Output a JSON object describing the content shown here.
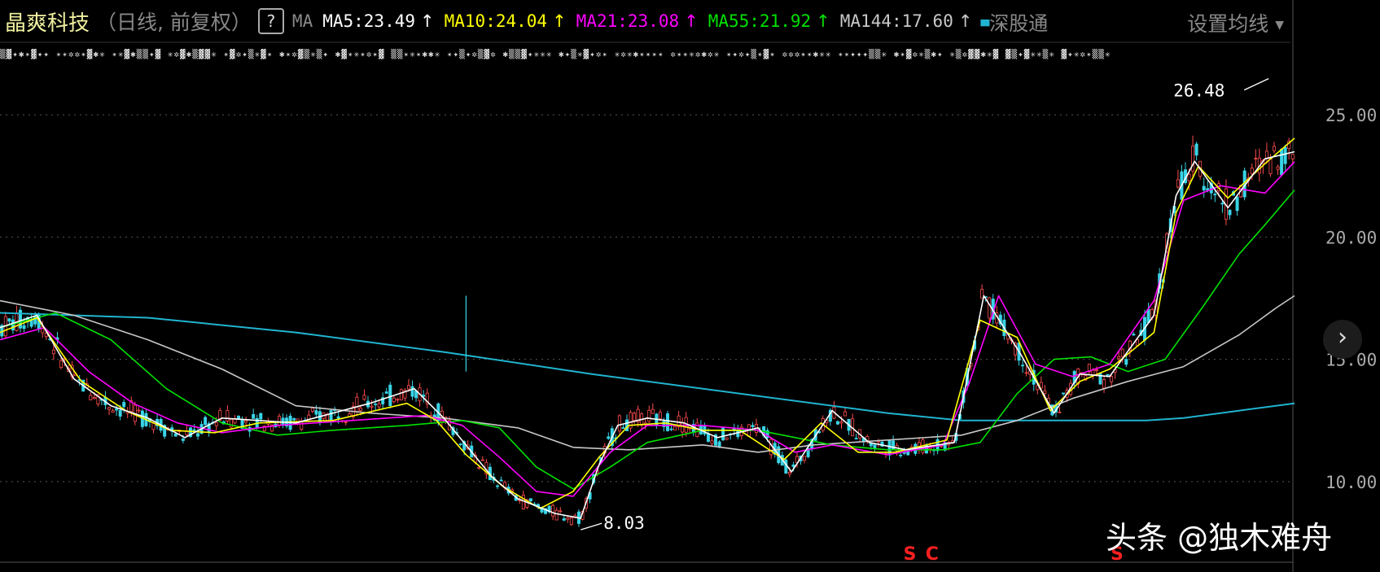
{
  "header": {
    "stock_name": "晶爽科技",
    "adjustment": "（日线, 前复权）",
    "help": "?",
    "ma_label": "MA",
    "ma_settings": "设置均线",
    "connect": "深股通"
  },
  "colors": {
    "background": "#000000",
    "up_candle": "#ff4d4d",
    "down_candle": "#39d4e6",
    "ma5": "#ffffff",
    "ma10": "#ffff00",
    "ma21": "#ff00ff",
    "ma55": "#00e000",
    "ma144": "#c8c8c8",
    "long_ma": "#20b4d0",
    "signal": "#ff2020"
  },
  "chart_data": {
    "type": "line",
    "ylim": [
      8,
      26.5
    ],
    "yticks": [
      10,
      15,
      20,
      25
    ],
    "ytick_labels": [
      "10.00",
      "15.00",
      "20.00",
      "25.00"
    ],
    "annotations": [
      {
        "label": "26.48",
        "x": 343,
        "y": 26.48
      },
      {
        "label": "8.03",
        "x": 157,
        "y": 8.03
      }
    ],
    "signals": [
      {
        "label": "S",
        "x": 246
      },
      {
        "label": "C",
        "x": 252
      },
      {
        "label": "S",
        "x": 302
      }
    ],
    "series": [
      {
        "name": "MA5",
        "legend": "MA5:23.49",
        "trend": "↑",
        "color": "#ffffff",
        "x": [
          0,
          10,
          20,
          30,
          40,
          50,
          60,
          80,
          100,
          112,
          120,
          133,
          140,
          150,
          157,
          162,
          167,
          175,
          185,
          194,
          205,
          214,
          225,
          235,
          245,
          258,
          266,
          276,
          285,
          292,
          300,
          312,
          318,
          323,
          332,
          342,
          350
        ],
        "values": [
          16.3,
          16.8,
          14.2,
          13.1,
          12.6,
          11.8,
          12.6,
          12.4,
          13.2,
          13.8,
          12.6,
          10.2,
          9.3,
          8.7,
          8.5,
          10.7,
          12.3,
          12.6,
          12.4,
          11.8,
          12.2,
          10.4,
          12.9,
          11.6,
          11.3,
          11.6,
          17.6,
          15.2,
          12.8,
          14.4,
          14.3,
          16.8,
          21.7,
          23.1,
          21.2,
          23.2,
          23.49
        ]
      },
      {
        "name": "MA10",
        "legend": "MA10:24.04",
        "trend": "↑",
        "color": "#ffff00",
        "x": [
          0,
          10,
          22,
          34,
          46,
          58,
          70,
          90,
          110,
          118,
          126,
          136,
          146,
          155,
          162,
          170,
          180,
          190,
          200,
          212,
          222,
          232,
          242,
          256,
          265,
          275,
          284,
          292,
          300,
          312,
          318,
          324,
          332,
          342,
          350
        ],
        "values": [
          16.1,
          16.7,
          14.1,
          12.9,
          12.1,
          12.0,
          12.4,
          12.5,
          13.2,
          12.5,
          11.1,
          9.8,
          8.9,
          9.6,
          11.0,
          12.3,
          12.4,
          12.1,
          12.1,
          10.9,
          12.4,
          11.2,
          11.2,
          11.7,
          16.6,
          15.9,
          12.9,
          14.1,
          14.6,
          16.1,
          21.0,
          22.9,
          21.6,
          23.0,
          24.04
        ]
      },
      {
        "name": "MA21",
        "legend": "MA21:23.08",
        "trend": "↑",
        "color": "#ff00ff",
        "x": [
          0,
          12,
          24,
          36,
          48,
          60,
          75,
          95,
          115,
          125,
          135,
          145,
          155,
          165,
          175,
          190,
          205,
          215,
          225,
          240,
          255,
          262,
          270,
          280,
          290,
          300,
          312,
          320,
          330,
          342,
          350
        ],
        "values": [
          15.8,
          16.3,
          14.5,
          13.2,
          12.4,
          12.0,
          12.3,
          12.5,
          12.7,
          12.3,
          11.0,
          9.6,
          9.4,
          11.2,
          12.3,
          12.3,
          12.1,
          11.2,
          11.5,
          11.1,
          11.5,
          14.0,
          17.6,
          14.8,
          14.3,
          14.8,
          17.4,
          21.5,
          22.1,
          21.8,
          23.08
        ]
      },
      {
        "name": "MA55",
        "legend": "MA55:21.92",
        "trend": "↑",
        "color": "#00e000",
        "x": [
          0,
          15,
          30,
          45,
          60,
          75,
          90,
          110,
          125,
          135,
          145,
          155,
          165,
          175,
          190,
          205,
          215,
          225,
          240,
          255,
          265,
          275,
          285,
          295,
          305,
          315,
          325,
          335,
          342,
          350
        ],
        "values": [
          16.3,
          16.9,
          15.8,
          13.8,
          12.4,
          11.9,
          12.1,
          12.3,
          12.5,
          12.2,
          10.6,
          9.7,
          10.6,
          11.6,
          12.1,
          12.1,
          11.8,
          11.5,
          11.3,
          11.3,
          11.6,
          13.6,
          15.0,
          15.1,
          14.5,
          15.0,
          17.1,
          19.3,
          20.5,
          21.92
        ]
      },
      {
        "name": "MA144",
        "legend": "MA144:17.60",
        "trend": "↑",
        "color": "#c8c8c8",
        "x": [
          0,
          20,
          40,
          60,
          80,
          100,
          120,
          140,
          155,
          170,
          190,
          205,
          220,
          240,
          260,
          275,
          290,
          305,
          320,
          335,
          345,
          350
        ],
        "values": [
          17.4,
          16.8,
          15.8,
          14.6,
          13.1,
          12.8,
          12.6,
          12.2,
          11.4,
          11.3,
          11.5,
          11.2,
          11.5,
          11.7,
          11.9,
          12.5,
          13.4,
          14.1,
          14.7,
          16.0,
          17.1,
          17.6
        ]
      },
      {
        "name": "MA250",
        "color": "#20b4d0",
        "x": [
          0,
          40,
          80,
          120,
          160,
          200,
          240,
          260,
          270,
          290,
          310,
          320,
          335,
          350
        ],
        "values": [
          16.9,
          16.7,
          16.1,
          15.3,
          14.4,
          13.6,
          12.8,
          12.5,
          12.5,
          12.5,
          12.5,
          12.6,
          12.9,
          13.2
        ]
      }
    ]
  }
}
